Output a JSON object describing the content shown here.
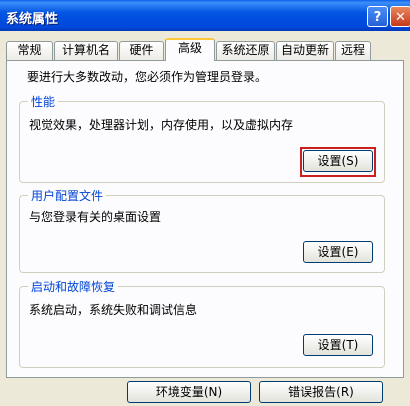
{
  "window": {
    "title": "系统属性",
    "help_glyph": "?",
    "close_glyph": "✕"
  },
  "tabs": [
    {
      "label": "常规"
    },
    {
      "label": "计算机名"
    },
    {
      "label": "硬件"
    },
    {
      "label": "高级",
      "active": true
    },
    {
      "label": "系统还原"
    },
    {
      "label": "自动更新"
    },
    {
      "label": "远程"
    }
  ],
  "admin_note": "要进行大多数改动，您必须作为管理员登录。",
  "performance": {
    "label": "性能",
    "description": "视觉效果，处理器计划，内存使用，以及虚拟内存",
    "button": "设置(S)"
  },
  "user_profiles": {
    "label": "用户配置文件",
    "description": "与您登录有关的桌面设置",
    "button": "设置(E)"
  },
  "startup_recovery": {
    "label": "启动和故障恢复",
    "description": "系统启动，系统失败和调试信息",
    "button": "设置(T)"
  },
  "footer": {
    "env_vars_button": "环境变量(N)",
    "error_report_button": "错误报告(R)"
  },
  "colors": {
    "title_bar": "#0355E3",
    "group_label": "#0046D5",
    "highlight": "#CC1F1F"
  }
}
